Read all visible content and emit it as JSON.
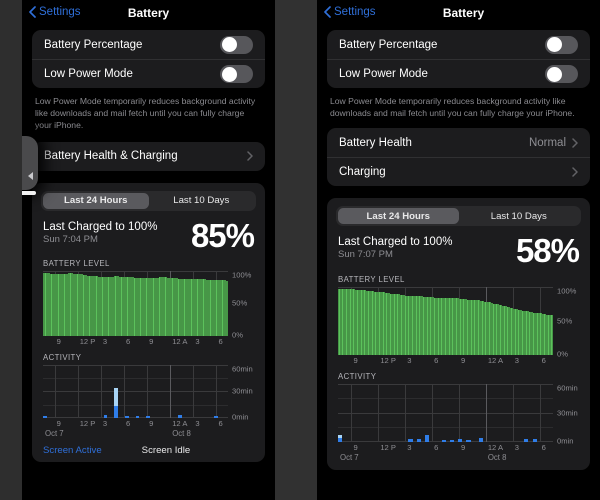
{
  "left_panel": {
    "nav": {
      "back_label": "Settings",
      "title": "Battery"
    },
    "settings_card": [
      {
        "label": "Battery Percentage",
        "control": "toggle",
        "state": "off"
      },
      {
        "label": "Low Power Mode",
        "control": "toggle",
        "state": "off"
      }
    ],
    "footnote": "Low Power Mode temporarily reduces background activity like downloads and mail fetch until you can fully charge your iPhone.",
    "health_card": [
      {
        "label": "Battery Health & Charging",
        "value": ""
      }
    ],
    "usage": {
      "segments": [
        {
          "label": "Last 24 Hours",
          "selected": true
        },
        {
          "label": "Last 10 Days",
          "selected": false
        }
      ],
      "last_charged_title": "Last Charged to 100%",
      "last_charged_time": "Sun 7:04 PM",
      "battery_percent": "85%",
      "battery_level_label": "BATTERY LEVEL",
      "activity_label": "ACTIVITY",
      "legend": [
        {
          "label": "Screen Active",
          "color": "#2f6fd8"
        },
        {
          "label": "Screen Idle",
          "color": "#e9e9ea"
        }
      ]
    }
  },
  "right_panel": {
    "nav": {
      "back_label": "Settings",
      "title": "Battery"
    },
    "settings_card": [
      {
        "label": "Battery Percentage",
        "control": "toggle",
        "state": "off"
      },
      {
        "label": "Low Power Mode",
        "control": "toggle",
        "state": "off"
      }
    ],
    "footnote": "Low Power Mode temporarily reduces background activity like downloads and mail fetch until you can fully charge your iPhone.",
    "health_card": [
      {
        "label": "Battery Health",
        "value": "Normal"
      },
      {
        "label": "Charging",
        "value": ""
      }
    ],
    "usage": {
      "segments": [
        {
          "label": "Last 24 Hours",
          "selected": true
        },
        {
          "label": "Last 10 Days",
          "selected": false
        }
      ],
      "last_charged_title": "Last Charged to 100%",
      "last_charged_time": "Sun 7:07 PM",
      "battery_percent": "58%",
      "battery_level_label": "BATTERY LEVEL",
      "activity_label": "ACTIVITY"
    }
  },
  "colors": {
    "accent_blue": "#2f6fd8",
    "battery_green": "#5cc25c",
    "activity_active": "#2f7de8",
    "activity_idle": "#a8d4f5",
    "card_bg": "#1c1c1e",
    "page_bg": "#000000",
    "secondary_text": "#8e8e93"
  },
  "chart_data": [
    {
      "id": "left-battery-level",
      "type": "bar",
      "title": "BATTERY LEVEL",
      "panel": "left",
      "ylabel": "",
      "ylim": [
        0,
        100
      ],
      "ytick_labels": [
        "100%",
        "50%",
        "0%"
      ],
      "ytick_values": [
        100,
        50,
        0
      ],
      "xlabel": "",
      "xtick_labels": [
        "9",
        "12 P",
        "3",
        "6",
        "9",
        "12 A",
        "3",
        "6"
      ],
      "day_labels": [
        "Oct 7",
        "Oct 8"
      ],
      "grid": true,
      "series_color": "#5cc25c",
      "values": [
        97,
        97,
        97,
        97,
        97,
        97,
        96,
        96,
        96,
        96,
        96,
        96,
        96,
        96,
        96,
        96,
        96,
        96,
        96,
        96,
        96,
        97,
        97,
        97,
        97,
        96,
        96,
        96,
        96,
        96,
        96,
        95,
        95,
        95,
        94,
        94,
        94,
        93,
        93,
        93,
        92,
        92,
        92,
        92,
        92,
        92,
        91,
        91,
        91,
        91,
        91,
        91,
        91,
        91,
        91,
        91,
        91,
        91,
        91,
        91,
        92,
        92,
        92,
        92,
        91,
        91,
        91,
        91,
        91,
        91,
        90,
        90,
        90,
        90,
        90,
        90,
        90,
        89,
        89,
        89,
        89,
        89,
        89,
        89,
        89,
        89,
        89,
        89,
        89,
        89,
        89,
        89,
        89,
        89,
        89,
        89,
        89,
        89,
        90,
        90,
        90,
        90,
        90,
        90,
        89,
        89,
        89,
        89,
        89,
        89,
        89,
        89,
        89,
        89,
        88,
        88,
        88,
        88,
        88,
        88,
        88,
        88,
        88,
        88,
        88,
        87,
        87,
        87,
        87,
        87,
        87,
        87,
        87,
        87,
        87,
        87,
        87,
        86,
        86,
        86,
        86,
        86,
        86,
        86,
        86,
        86,
        86,
        86,
        86,
        86,
        86,
        86,
        86,
        86,
        85,
        85
      ]
    },
    {
      "id": "left-activity",
      "type": "bar",
      "title": "ACTIVITY",
      "panel": "left",
      "stacked": true,
      "ylim": [
        0,
        60
      ],
      "ytick_labels": [
        "60min",
        "30min",
        "0min"
      ],
      "ytick_values": [
        60,
        30,
        0
      ],
      "xtick_labels": [
        "9",
        "12 P",
        "3",
        "6",
        "9",
        "12 A",
        "3",
        "6"
      ],
      "day_labels": [
        "Oct 7",
        "Oct 8"
      ],
      "grid": true,
      "series": [
        {
          "name": "Screen Active",
          "color": "#2f7de8",
          "values": [
            2,
            0,
            0,
            0,
            0,
            0,
            0,
            0,
            0,
            0,
            0,
            0,
            0,
            0,
            0,
            0,
            0,
            3,
            0,
            0,
            13,
            0,
            0,
            2,
            0,
            0,
            2,
            0,
            0,
            2,
            0,
            0,
            0,
            0,
            0,
            0,
            0,
            0,
            3,
            0,
            0,
            0,
            0,
            0,
            0,
            0,
            0,
            0,
            2,
            0,
            0,
            0
          ]
        },
        {
          "name": "Screen Idle",
          "color": "#a8d4f5",
          "values": [
            0,
            0,
            0,
            0,
            0,
            0,
            0,
            0,
            0,
            0,
            0,
            0,
            0,
            0,
            0,
            0,
            0,
            0,
            0,
            0,
            21,
            0,
            0,
            0,
            0,
            0,
            0,
            0,
            0,
            0,
            0,
            0,
            0,
            0,
            0,
            0,
            0,
            0,
            0,
            0,
            0,
            0,
            0,
            0,
            0,
            0,
            0,
            0,
            0,
            0,
            0,
            0
          ]
        }
      ]
    },
    {
      "id": "right-battery-level",
      "type": "bar",
      "title": "BATTERY LEVEL",
      "panel": "right",
      "ylim": [
        0,
        100
      ],
      "ytick_labels": [
        "100%",
        "50%",
        "0%"
      ],
      "ytick_values": [
        100,
        50,
        0
      ],
      "xtick_labels": [
        "9",
        "12 P",
        "3",
        "6",
        "9",
        "12 A",
        "3",
        "6"
      ],
      "day_labels": [
        "Oct 7",
        "Oct 8"
      ],
      "grid": true,
      "series_color": "#5cc25c",
      "values": [
        97,
        97,
        97,
        97,
        97,
        97,
        96,
        96,
        96,
        96,
        96,
        96,
        95,
        95,
        95,
        95,
        95,
        95,
        95,
        95,
        94,
        94,
        94,
        94,
        94,
        94,
        93,
        93,
        93,
        93,
        92,
        92,
        92,
        92,
        91,
        91,
        91,
        91,
        90,
        90,
        90,
        90,
        89,
        89,
        89,
        88,
        88,
        88,
        88,
        87,
        87,
        87,
        87,
        87,
        86,
        86,
        86,
        86,
        86,
        86,
        86,
        86,
        85,
        85,
        85,
        85,
        85,
        85,
        85,
        85,
        84,
        84,
        84,
        84,
        84,
        84,
        84,
        84,
        84,
        84,
        83,
        83,
        83,
        83,
        83,
        83,
        83,
        83,
        82,
        82,
        82,
        82,
        82,
        82,
        81,
        81,
        81,
        81,
        81,
        80,
        80,
        80,
        80,
        79,
        79,
        79,
        78,
        78,
        78,
        77,
        77,
        76,
        76,
        75,
        75,
        74,
        74,
        73,
        73,
        72,
        72,
        71,
        71,
        70,
        70,
        69,
        69,
        68,
        68,
        67,
        67,
        66,
        66,
        66,
        65,
        65,
        64,
        64,
        64,
        63,
        63,
        63,
        62,
        62,
        62,
        61,
        61,
        61,
        60,
        60,
        60,
        59,
        59,
        59,
        58,
        58
      ]
    },
    {
      "id": "right-activity",
      "type": "bar",
      "title": "ACTIVITY",
      "panel": "right",
      "stacked": true,
      "ylim": [
        0,
        60
      ],
      "ytick_labels": [
        "60min",
        "30min",
        "0min"
      ],
      "ytick_values": [
        60,
        30,
        0
      ],
      "xtick_labels": [
        "9",
        "12 P",
        "3",
        "6",
        "9",
        "12 A",
        "3",
        "6"
      ],
      "day_labels": [
        "Oct 7",
        "Oct 8"
      ],
      "grid": true,
      "series": [
        {
          "name": "Screen Active",
          "color": "#2f7de8",
          "values": [
            4,
            0,
            0,
            0,
            0,
            0,
            0,
            0,
            0,
            0,
            0,
            0,
            0,
            0,
            0,
            0,
            0,
            3,
            0,
            3,
            0,
            7,
            0,
            0,
            0,
            2,
            0,
            2,
            0,
            3,
            0,
            2,
            0,
            0,
            4,
            0,
            0,
            0,
            0,
            0,
            0,
            0,
            0,
            0,
            0,
            3,
            0,
            3,
            0,
            0,
            0,
            0
          ]
        },
        {
          "name": "Screen Idle",
          "color": "#a8d4f5",
          "values": [
            3,
            0,
            0,
            0,
            0,
            0,
            0,
            0,
            0,
            0,
            0,
            0,
            0,
            0,
            0,
            0,
            0,
            0,
            0,
            0,
            0,
            0,
            0,
            0,
            0,
            0,
            0,
            0,
            0,
            0,
            0,
            0,
            0,
            0,
            0,
            0,
            0,
            0,
            0,
            0,
            0,
            0,
            0,
            0,
            0,
            0,
            0,
            0,
            0,
            0,
            0,
            0
          ]
        }
      ]
    }
  ],
  "overlay": {
    "swipe_hint_icon": "back-triangle-icon"
  }
}
